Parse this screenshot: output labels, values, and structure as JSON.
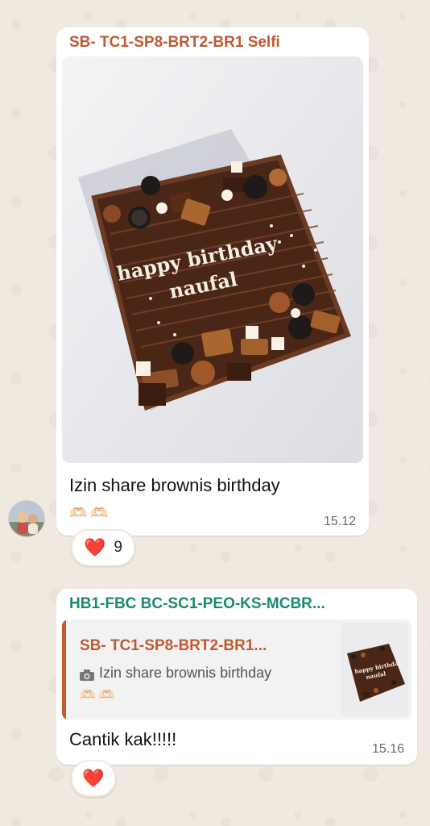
{
  "colors": {
    "chat_bg": "#efe9e0",
    "bubble_bg": "#ffffff",
    "sender1_color": "#c05a33",
    "sender2_color": "#1a8a6c",
    "quote_bar": "#c8572b",
    "heart": "#e41e3f"
  },
  "messages": [
    {
      "sender": "SB- TC1-SP8-BRT2-BR1 Selfi",
      "image_text": [
        "happy birthday",
        "naufal"
      ],
      "text": "Izin share brownis birthday",
      "emoji": "🫶🏻🫶🏻",
      "time": "15.12",
      "reaction": {
        "emoji": "❤️",
        "count": "9"
      }
    },
    {
      "sender": "HB1-FBC BC-SC1-PEO-KS-MCBR...",
      "quoted": {
        "sender": "SB- TC1-SP8-BRT2-BR1...",
        "text": "Izin share brownis birthday",
        "emoji": "🫶🏻🫶🏻"
      },
      "text": "Cantik kak!!!!!",
      "time": "15.16",
      "reaction": {
        "emoji": "❤️"
      }
    }
  ]
}
